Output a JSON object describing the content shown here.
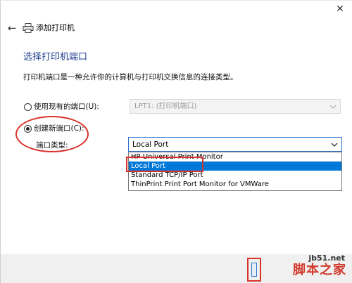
{
  "window": {
    "close_glyph": "✕"
  },
  "wizard": {
    "back_glyph": "←",
    "title": "添加打印机",
    "heading": "选择打印机端口",
    "description": "打印机端口是一种允许你的计算机与打印机交换信息的连接类型。"
  },
  "options": {
    "use_existing": {
      "label": "使用现有的端口(U):",
      "selected": false,
      "value": "LPT1: (打印机端口)"
    },
    "create_new": {
      "label": "创建新端口(C):",
      "selected": true
    }
  },
  "port_type": {
    "label": "端口类型:",
    "value": "Local Port",
    "options": [
      "HP Universal Print Monitor",
      "Local Port",
      "Standard TCP/IP Port",
      "ThinPrint Print Port Monitor for VMWare"
    ],
    "highlighted_option": "Local Port"
  },
  "watermark": {
    "url": "jb51.net",
    "brand": "脚本之家"
  },
  "colors": {
    "accent": "#0078d7",
    "annotation_red": "#d9342b",
    "heading_blue": "#1f3f8f"
  },
  "icons": {
    "back": "back-arrow-icon",
    "printer": "printer-icon",
    "close": "close-icon",
    "chevron": "chevron-down-icon"
  }
}
